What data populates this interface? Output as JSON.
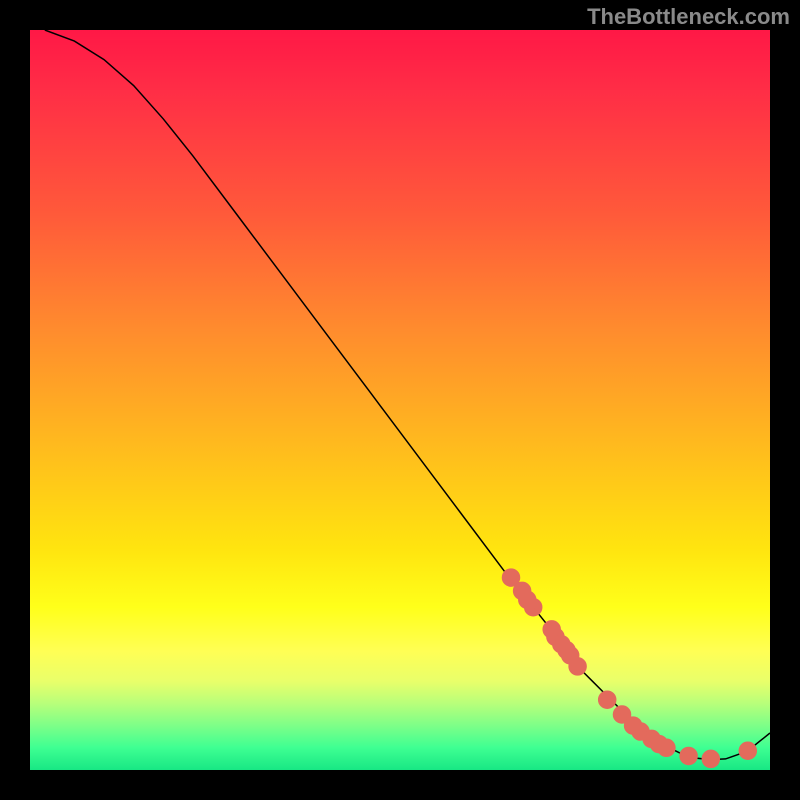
{
  "attribution": "TheBottleneck.com",
  "colors": {
    "dot": "#e36a5c",
    "curve": "#000000"
  },
  "chart_data": {
    "type": "line",
    "title": "",
    "xlabel": "",
    "ylabel": "",
    "xlim": [
      0,
      100
    ],
    "ylim": [
      0,
      100
    ],
    "grid": false,
    "legend": false,
    "series": [
      {
        "name": "curve",
        "style": "line",
        "x": [
          2,
          6,
          10,
          14,
          18,
          22,
          28,
          34,
          40,
          46,
          52,
          58,
          64,
          68,
          72,
          74,
          76,
          78,
          80,
          82,
          84,
          86,
          88,
          90,
          92,
          94,
          96,
          98,
          100
        ],
        "y": [
          100,
          98.5,
          96,
          92.5,
          88,
          83,
          75,
          67,
          59,
          51,
          43,
          35,
          27,
          22,
          17,
          14,
          12,
          10,
          8,
          6,
          4.5,
          3.2,
          2.2,
          1.6,
          1.4,
          1.5,
          2.2,
          3.4,
          5
        ]
      },
      {
        "name": "highlight-dots",
        "style": "scatter",
        "x": [
          65,
          66.5,
          67.2,
          68,
          70.5,
          71,
          71.8,
          72.5,
          73,
          74,
          78,
          80,
          81.5,
          82.5,
          84,
          85,
          86,
          89,
          92,
          97
        ],
        "y": [
          26,
          24.2,
          23,
          22,
          19,
          18,
          17,
          16.2,
          15.5,
          14,
          9.5,
          7.5,
          6,
          5.2,
          4.2,
          3.5,
          3,
          1.9,
          1.5,
          2.6
        ]
      }
    ]
  }
}
